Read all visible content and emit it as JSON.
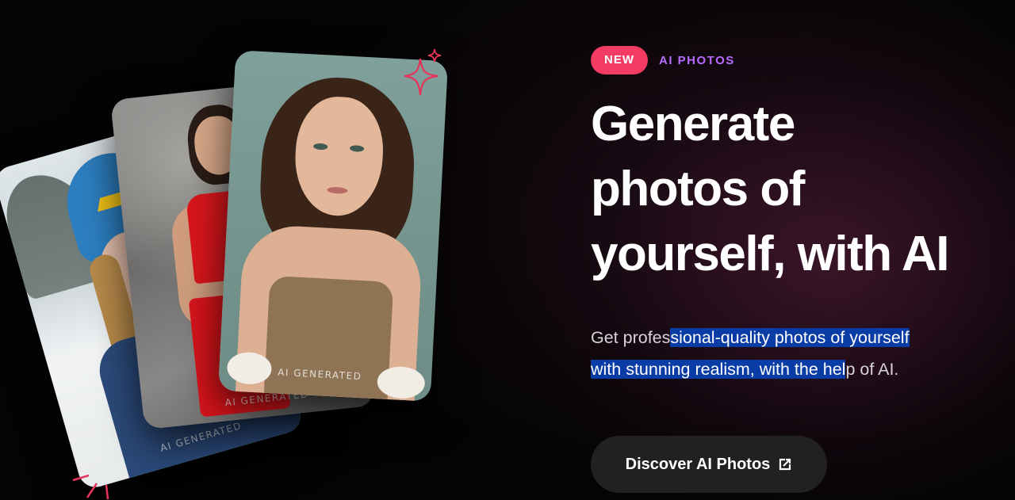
{
  "hero": {
    "badge": "NEW",
    "tag": "AI PHOTOS",
    "headline_lines": [
      "Generate",
      "photos of",
      "yourself, with AI"
    ],
    "sub_part1": "Get profes",
    "sub_highlight1": "sional-quality photos of yourself",
    "sub_highlight2": "with stunning realism, with the hel",
    "sub_part2": "p of AI."
  },
  "cta": {
    "label": "Discover AI Photos",
    "icon": "external-link-icon"
  },
  "cards": {
    "watermark": "AI GENERATED"
  },
  "colors": {
    "badge_bg": "#f23c63",
    "tag": "#b56bff",
    "highlight": "#0a3ca6",
    "button_bg": "#222023"
  }
}
